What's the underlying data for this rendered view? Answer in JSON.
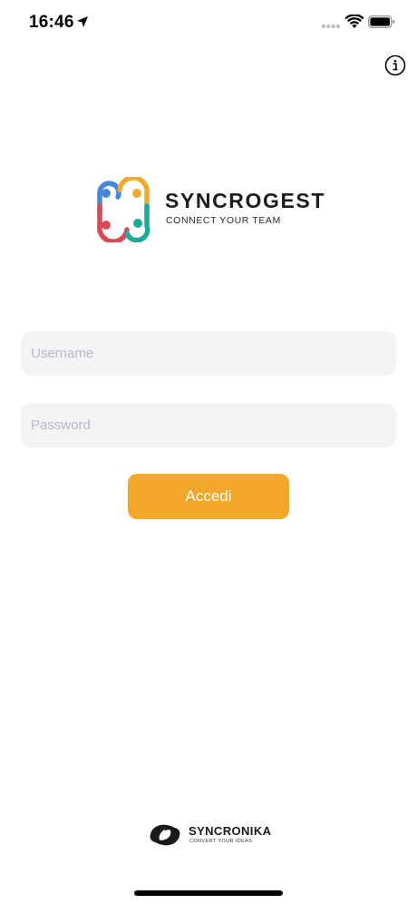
{
  "status_bar": {
    "time": "16:46",
    "icons": [
      "location-arrow-icon",
      "cellular-signal-icon",
      "wifi-icon",
      "battery-icon"
    ]
  },
  "info_icon": "info-circle-icon",
  "logo": {
    "title": "SYNCROGEST",
    "tagline": "CONNECT YOUR TEAM",
    "colors": {
      "blue": "#4a86d6",
      "orange": "#f2a930",
      "red": "#d84a55",
      "teal": "#1fa89a"
    }
  },
  "form": {
    "username_placeholder": "Username",
    "password_placeholder": "Password",
    "username_value": "",
    "password_value": "",
    "submit_label": "Accedi"
  },
  "footer": {
    "brand_name": "SYNCRONIKA",
    "brand_tagline": "CONVERT YOUR IDEAS"
  },
  "colors": {
    "accent": "#f3a72c",
    "field_background": "#f2f3f5",
    "placeholder": "#b7bac0"
  }
}
